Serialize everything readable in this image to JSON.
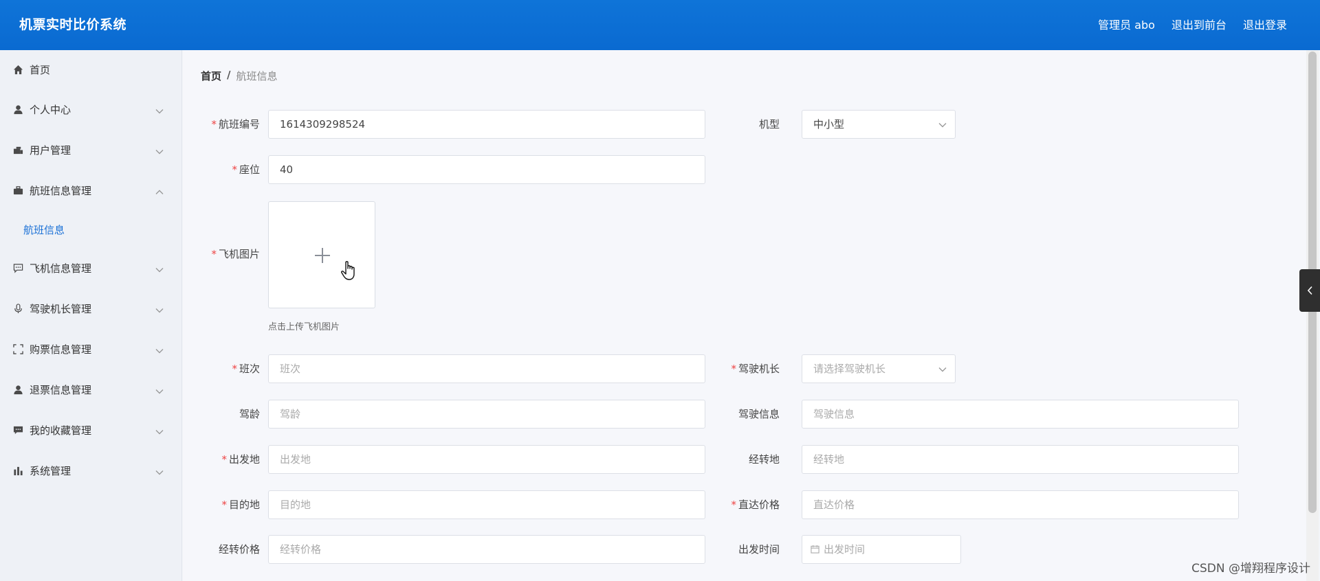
{
  "header": {
    "title": "机票实时比价系统",
    "admin_label": "管理员 abo",
    "back_to_front": "退出到前台",
    "logout": "退出登录"
  },
  "sidebar": {
    "items": [
      {
        "label": "首页",
        "icon": "home-icon"
      },
      {
        "label": "个人中心",
        "icon": "user-icon"
      },
      {
        "label": "用户管理",
        "icon": "users-icon"
      },
      {
        "label": "航班信息管理",
        "icon": "briefcase-icon"
      },
      {
        "label": "飞机信息管理",
        "icon": "message-icon"
      },
      {
        "label": "驾驶机长管理",
        "icon": "microphone-icon"
      },
      {
        "label": "购票信息管理",
        "icon": "fullscreen-icon"
      },
      {
        "label": "退票信息管理",
        "icon": "user-icon"
      },
      {
        "label": "我的收藏管理",
        "icon": "chat-icon"
      },
      {
        "label": "系统管理",
        "icon": "bar-chart-icon"
      }
    ],
    "submenu": {
      "label": "航班信息"
    }
  },
  "breadcrumb": {
    "home": "首页",
    "separator": "/",
    "current": "航班信息"
  },
  "form": {
    "flight_no": {
      "label": "航班编号",
      "value": "1614309298524",
      "required": true
    },
    "model": {
      "label": "机型",
      "value": "中小型"
    },
    "seats": {
      "label": "座位",
      "value": "40",
      "required": true
    },
    "image": {
      "label": "飞机图片",
      "tip": "点击上传飞机图片",
      "required": true
    },
    "shift": {
      "label": "班次",
      "placeholder": "班次",
      "required": true
    },
    "captain": {
      "label": "驾驶机长",
      "placeholder": "请选择驾驶机长",
      "required": true
    },
    "pilot_age": {
      "label": "驾龄",
      "placeholder": "驾龄"
    },
    "pilot_info": {
      "label": "驾驶信息",
      "placeholder": "驾驶信息"
    },
    "origin": {
      "label": "出发地",
      "placeholder": "出发地",
      "required": true
    },
    "transit": {
      "label": "经转地",
      "placeholder": "经转地"
    },
    "destination": {
      "label": "目的地",
      "placeholder": "目的地",
      "required": true
    },
    "direct_price": {
      "label": "直达价格",
      "placeholder": "直达价格",
      "required": true
    },
    "transit_price": {
      "label": "经转价格",
      "placeholder": "经转价格"
    },
    "depart_time": {
      "label": "出发时间",
      "placeholder": "出发时间"
    }
  },
  "watermark": "CSDN @增翔程序设计",
  "colors": {
    "header": "#0f74d8",
    "active_menu": "#1a70d6",
    "required": "#ee4444"
  }
}
